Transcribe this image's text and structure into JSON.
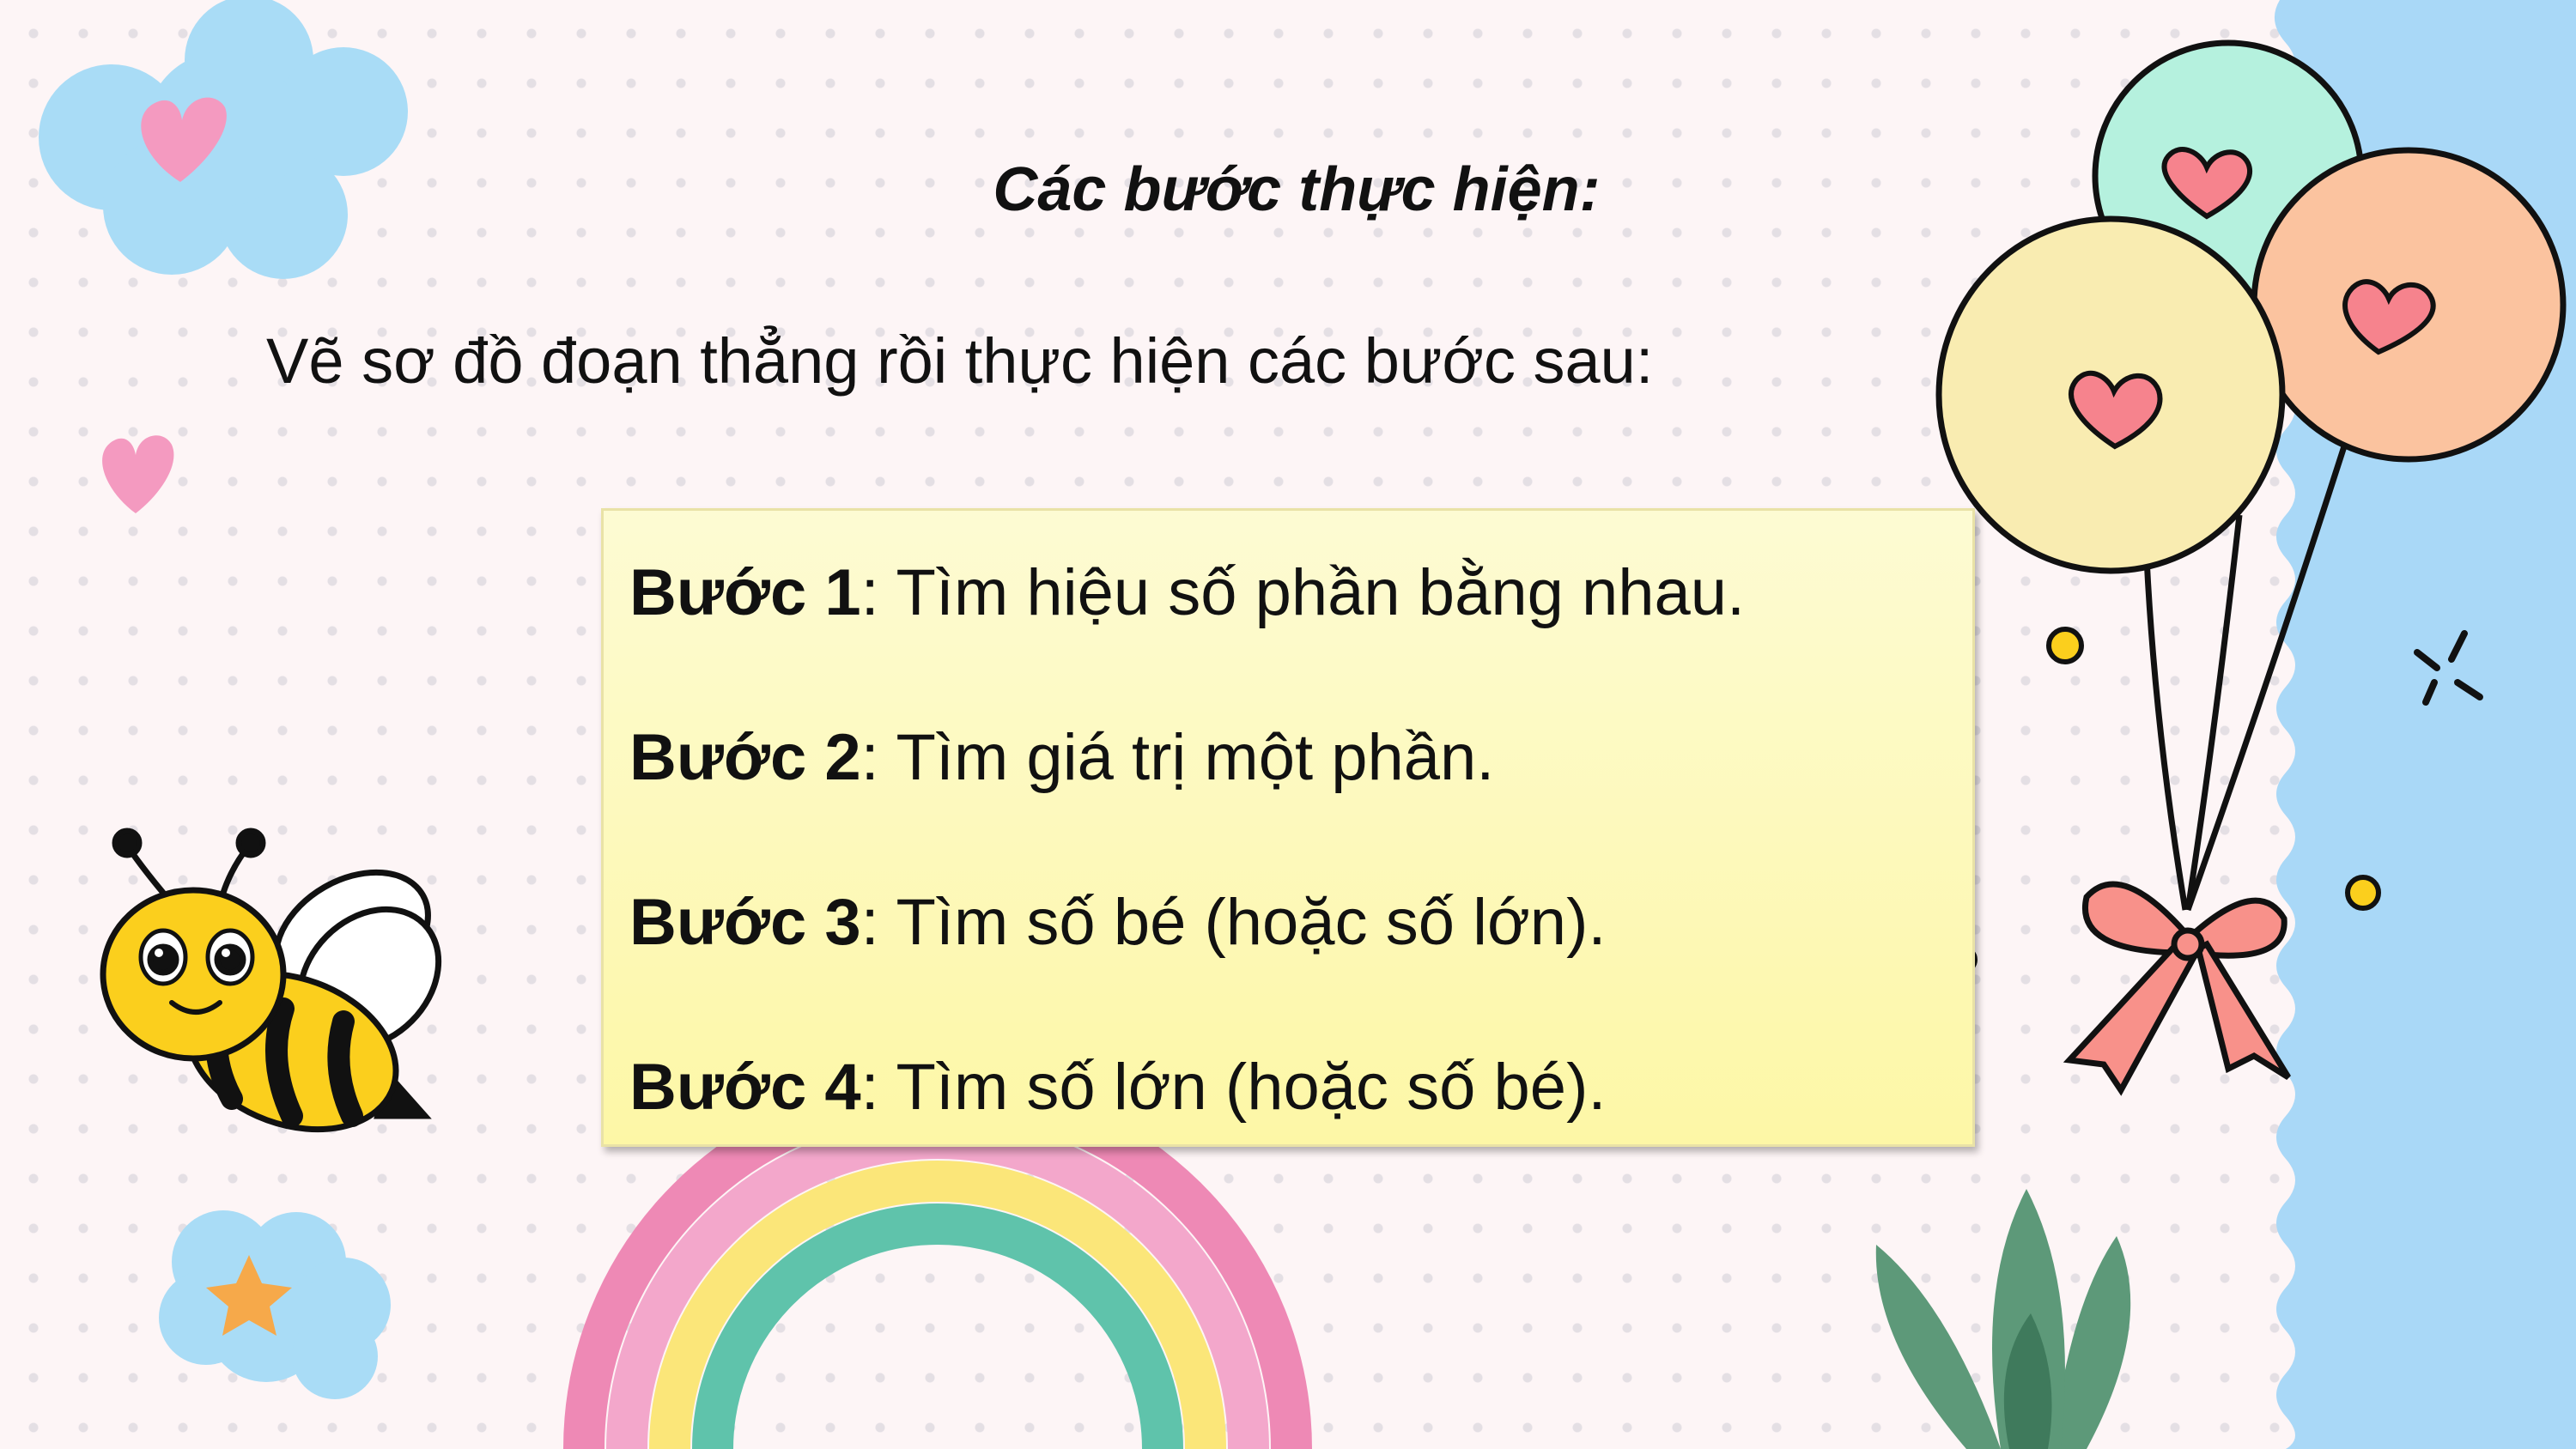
{
  "slide": {
    "title": "Các bước thực hiện:",
    "subtitle": "Vẽ sơ đồ đoạn thẳng rồi thực hiện các bước sau:",
    "steps": [
      {
        "label": "Bước 1",
        "text": ": Tìm hiệu số phần bằng nhau."
      },
      {
        "label": "Bước 2",
        "text": ": Tìm giá trị một phần."
      },
      {
        "label": "Bước 3",
        "text": ": Tìm số bé (hoặc số lớn)."
      },
      {
        "label": "Bước 4",
        "text": ": Tìm số lớn (hoặc số bé)."
      }
    ]
  },
  "decorations": {
    "icons": [
      "flower-icon",
      "heart-icon",
      "bee-icon",
      "balloons-icon",
      "rainbow-icon",
      "plant-icon",
      "star-flower-icon",
      "sparkle-icon"
    ],
    "colors": {
      "side_panel": "#a9d8f7",
      "box_top": "#fdfbd3",
      "box_bottom": "#fdf7a6",
      "balloon_mint": "#b5f1de",
      "balloon_yellow": "#f9ecb1",
      "balloon_peach": "#fbc39f",
      "heart": "#f6838d",
      "bee_yellow": "#fbcf1d",
      "rainbow_pink": "#ee89b5",
      "rainbow_yellow": "#fbe679",
      "rainbow_teal": "#5fc3ab",
      "plant": "#5d9979"
    }
  }
}
